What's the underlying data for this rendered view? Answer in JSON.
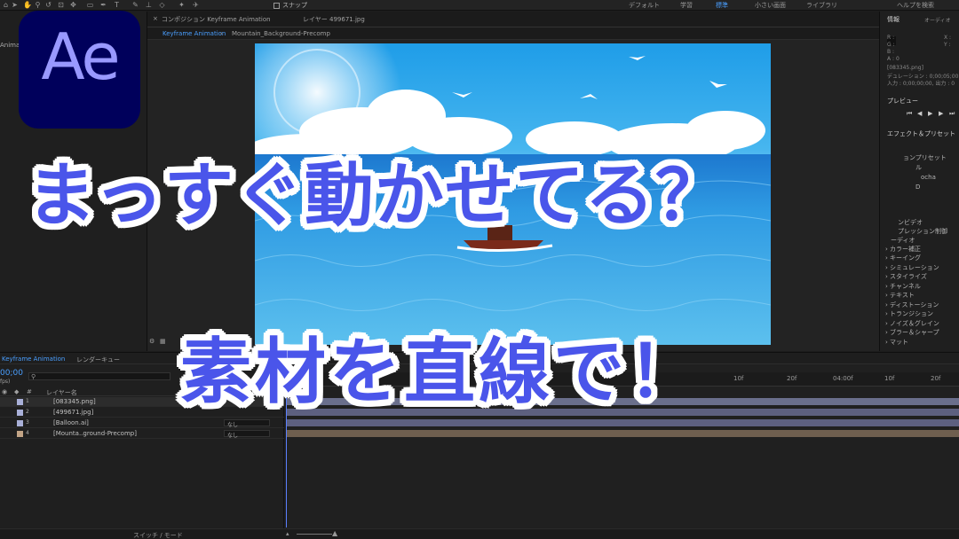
{
  "overlay": {
    "headline": "まっすぐ動かせてる？",
    "subheadline": "素材を直線で！",
    "logo_text": "Ae",
    "logo_bg": "#00005b",
    "logo_fg": "#9999ff",
    "headline_color": "#4a55ea"
  },
  "toolbar": {
    "snap_label": "スナップ",
    "workspaces": [
      "デフォルト",
      "学習",
      "標準",
      "小さい画面",
      "ライブラリ"
    ],
    "active_workspace": "標準",
    "help_search": "ヘルプを検索"
  },
  "project_panel": {
    "tab_label": "Animati"
  },
  "composition": {
    "tab_label": "コンポジション Keyframe Animation",
    "layer_tab": "レイヤー 499671.jpg",
    "breadcrumb_current": "Keyframe Animation",
    "breadcrumb_next": "Mountain_Background-Precomp"
  },
  "info_panel": {
    "title": "情報",
    "audio_tab": "オーディオ",
    "rgba": [
      "R :",
      "G :",
      "B :",
      "A : 0"
    ],
    "xy": [
      "X :",
      "Y :"
    ],
    "file": "[083345.png]",
    "duration": "デュレーション : 0;00;05;00",
    "in_out": "入力 : 0;00;00;00, 出力 : 0"
  },
  "preview_panel": {
    "title": "プレビュー"
  },
  "effects_panel": {
    "title": "エフェクト＆プリセット",
    "partial_items": [
      "ョンプリセット",
      "ル",
      "ocha",
      "D",
      "ンビデオ",
      "プレッション制御",
      "ーディオ"
    ],
    "items": [
      "カラー補正",
      "キーイング",
      "シミュレーション",
      "スタイライズ",
      "チャンネル",
      "テキスト",
      "ディストーション",
      "トランジション",
      "ノイズ＆グレイン",
      "ブラー＆シャープ",
      "マット"
    ]
  },
  "timeline": {
    "tab_label": "Keyframe Animation",
    "render_queue": "レンダーキュー",
    "timecode": "00;00",
    "fps": "fps)",
    "column_layer_name": "レイヤー名",
    "ruler_ticks": [
      "10f",
      "20f",
      "04:00f",
      "10f",
      "20f"
    ],
    "switch_mode": "スイッチ / モード",
    "layers": [
      {
        "num": "1",
        "name": "[083345.png]",
        "color": "#a9b0d8",
        "parent": ""
      },
      {
        "num": "2",
        "name": "[499671.jpg]",
        "color": "#a9b0d8",
        "parent": ""
      },
      {
        "num": "3",
        "name": "[Balloon.ai]",
        "color": "#a9b0d8",
        "parent": "なし"
      },
      {
        "num": "4",
        "name": "[Mounta..ground-Precomp]",
        "color": "#c2a486",
        "parent": "なし"
      }
    ]
  }
}
